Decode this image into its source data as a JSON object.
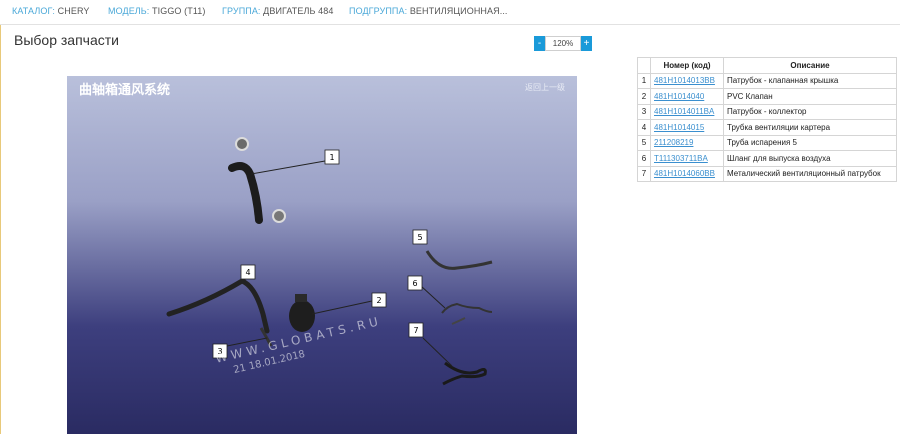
{
  "breadcrumb": [
    {
      "key": "КАТАЛОГ:",
      "value": "CHERY"
    },
    {
      "key": "МОДЕЛЬ:",
      "value": "TIGGO (T11)"
    },
    {
      "key": "ГРУППА:",
      "value": "ДВИГАТЕЛЬ 484"
    },
    {
      "key": "ПОДГРУППА:",
      "value": "ВЕНТИЛЯЦИОННАЯ..."
    }
  ],
  "page": {
    "title": "Выбор запчасти"
  },
  "zoom": {
    "minus": "-",
    "value": "120%",
    "plus": "+"
  },
  "diagram": {
    "header_cn": "曲轴箱通风系统",
    "header_right": "返回上一级",
    "watermark": "WWW.GLOBATS.RU",
    "watermark_date": "21 18.01.2018",
    "callouts": [
      "1",
      "2",
      "3",
      "4",
      "5",
      "6",
      "7"
    ]
  },
  "table": {
    "headers": [
      "",
      "Номер (код)",
      "Описание"
    ],
    "rows": [
      {
        "n": "1",
        "code": "481H1014013BB",
        "desc": "Патрубок - клапанная крышка"
      },
      {
        "n": "2",
        "code": "481H1014040",
        "desc": "PVC Клапан"
      },
      {
        "n": "3",
        "code": "481H1014011BA",
        "desc": "Патрубок - коллектор"
      },
      {
        "n": "4",
        "code": "481H1014015",
        "desc": "Трубка вентиляции картера"
      },
      {
        "n": "5",
        "code": "211208219",
        "desc": "Труба испарения 5"
      },
      {
        "n": "6",
        "code": "T111303711BA",
        "desc": "Шланг для выпуска воздуха"
      },
      {
        "n": "7",
        "code": "481H1014060BB",
        "desc": "Металический вентиляционный патрубок"
      }
    ]
  },
  "colors": {
    "accent": "#1a9ad9",
    "link": "#3a8fcf",
    "panel_border": "#e8c97a"
  }
}
